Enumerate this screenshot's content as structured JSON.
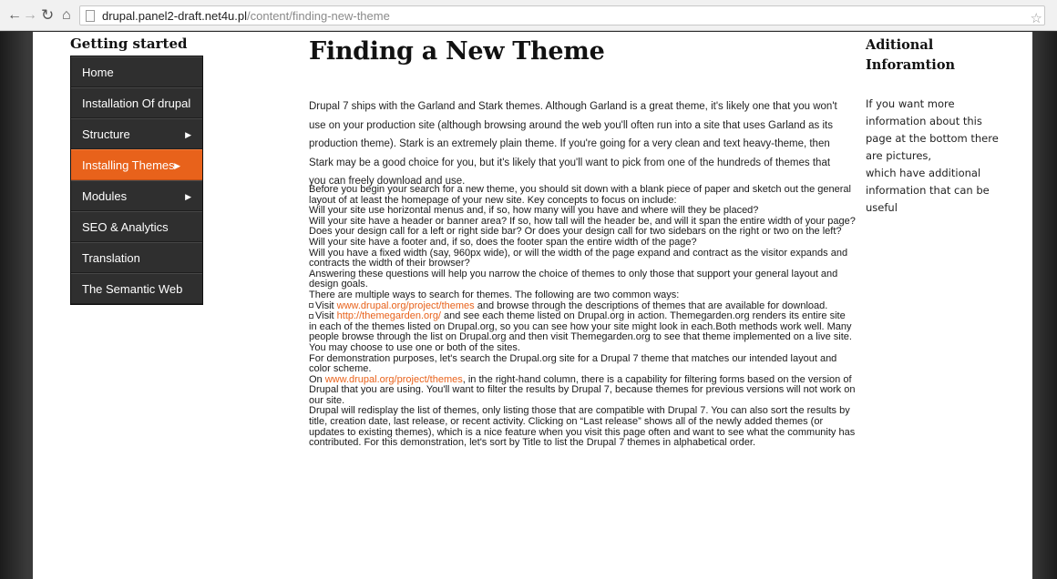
{
  "browser": {
    "url_host": "drupal.panel2-draft.net4u.pl",
    "url_path": "/content/finding-new-theme"
  },
  "sidebar": {
    "title": "Getting started",
    "items": [
      {
        "label": "Home",
        "active": false,
        "has_submenu": false
      },
      {
        "label": "Installation Of drupal",
        "active": false,
        "has_submenu": false
      },
      {
        "label": "Structure",
        "active": false,
        "has_submenu": true
      },
      {
        "label": "Installing Themes",
        "active": true,
        "has_submenu": true
      },
      {
        "label": "Modules",
        "active": false,
        "has_submenu": true
      },
      {
        "label": "SEO & Analytics",
        "active": false,
        "has_submenu": false
      },
      {
        "label": "Translation",
        "active": false,
        "has_submenu": false
      },
      {
        "label": "The Semantic Web",
        "active": false,
        "has_submenu": false
      }
    ]
  },
  "main": {
    "title": "Finding a New Theme",
    "intro": "Drupal 7 ships with the Garland and Stark themes. Although Garland is a great theme, it's likely one that you won't use on your production site (although browsing around the web you'll often run into a site that uses Garland as its production theme). Stark is an extremely plain theme. If you're going for a very clean and text heavy-theme, then Stark may be a good choice for you, but it's likely that you'll want to pick from one of the hundreds of themes that you can freely download and use.",
    "p1": "Before you begin your search for a new theme, you should sit down with a blank piece of paper and sketch out the general layout of at least the homepage of your new site. Key concepts to focus on include:",
    "q1": "Will your site use horizontal menus and, if so, how many will you have and where will they be placed?",
    "q2": "Will your site have a header or banner area? If so, how tall will the header be, and will it span the entire width of your page?",
    "q3": "Does your design call for a left or right side bar? Or does your design call for two sidebars on the right or two on the left?",
    "q4": "Will your site have a footer and, if so, does the footer span the entire width of the page?",
    "q5": "Will you have a fixed width (say, 960px wide), or will the width of the page expand and contract as the visitor expands and contracts the width of their browser?",
    "p2": "Answering these questions will help you narrow the choice of themes to only those that support your general layout and design goals.",
    "p3": "There are multiple ways to search for themes. The following are two common ways:",
    "b1_pre": "Visit ",
    "b1_link": "www.drupal.org/project/themes",
    "b1_post": " and browse through the descriptions of themes that are available for download.",
    "b2_pre": "Visit ",
    "b2_link": "http://themegarden.org/",
    "b2_post": " and see each theme listed on Drupal.org in action. Themegarden.org renders its entire site in each of the themes listed on Drupal.org, so you can see how your site might look in each.Both methods work well. Many people browse through the list on Drupal.org and then visit Themegarden.org to see that theme implemented on a live site. You may choose to use one or both of the sites.",
    "p4": "For demonstration purposes, let's search the Drupal.org site for a Drupal 7 theme that matches our intended layout and color scheme.",
    "p5_pre": "On ",
    "p5_link": "www.drupal.org/project/themes",
    "p5_post": ", in the right-hand column, there is a capability for filtering forms based on the version of Drupal that you are using. You'll want to filter the results by Drupal 7, because themes for previous versions will not work on our site.",
    "p6": "Drupal will redisplay the list of themes, only listing those that are compatible with Drupal 7. You can also sort the results by title, creation date, last release, or recent activity. Clicking on “Last release” shows all of the newly added themes (or updates to existing themes), which is a nice feature when you visit this page often and want to see what the community has contributed. For this demonstration, let's sort by Title to list the Drupal 7 themes in alphabetical order."
  },
  "aside": {
    "title": "Aditional Inforamtion",
    "text": "If you want more information about this page at the bottom there are pictures,\nwhich have additional information that can be useful"
  },
  "colors": {
    "accent": "#e8621b",
    "menu_bg": "#2f2f2f",
    "backdrop": "#3a3a3a"
  }
}
